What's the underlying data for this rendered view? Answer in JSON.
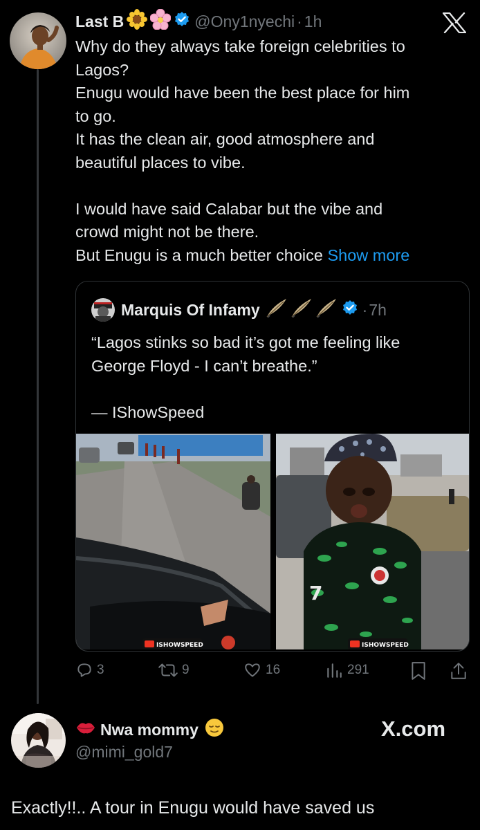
{
  "tweet": {
    "author_name": "Last B",
    "author_handle": "@Ony1nyechi",
    "separator": "·",
    "time": "1h",
    "lines": [
      "Why do they always take foreign celebrities to",
      "Lagos?",
      "Enugu would have been the best place for him",
      "to go.",
      "It has the clean air, good atmosphere and",
      "beautiful places to vibe."
    ],
    "lines2": [
      "I would have said Calabar but the vibe and",
      "crowd might not be there."
    ],
    "last_line": "But Enugu is a much better choice ",
    "show_more": "Show more"
  },
  "quote": {
    "author_name": "Marquis Of Infamy",
    "separator": "·",
    "time": "7h",
    "line1": "“Lagos stinks so bad it’s got me feeling like",
    "line2": "George Floyd - I can’t breathe.”",
    "attribution": "— IShowSpeed",
    "watermark": "ISHOWSPEED"
  },
  "actions": {
    "replies": "3",
    "reposts": "9",
    "likes": "16",
    "views": "291"
  },
  "reply": {
    "author_name": "Nwa mommy",
    "author_handle": "@mimi_gold7",
    "brand": "X.com",
    "text": "Exactly!!.. A tour in Enugu would have saved us"
  },
  "colors": {
    "background": "#000000",
    "text": "#e7e9ea",
    "muted": "#71767b",
    "link": "#1d9bf0",
    "verified": "#1d9bf0",
    "border": "#2f3336"
  }
}
